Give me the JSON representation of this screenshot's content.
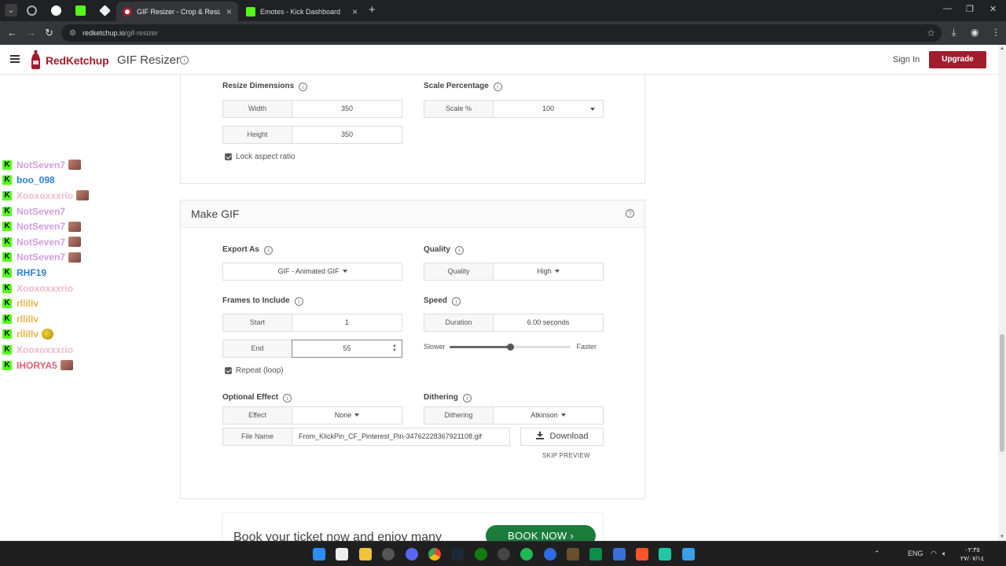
{
  "browser": {
    "tabs": [
      {
        "title": "GIF Resizer - Crop & Resize Ani",
        "active": true
      },
      {
        "title": "Emotes - Kick Dashboard",
        "active": false
      }
    ],
    "url_host": "redketchup.io",
    "url_path": "/gif-resizer"
  },
  "header": {
    "brand": "RedKetchup",
    "title": "GIF Resizer",
    "sign_in": "Sign In",
    "upgrade": "Upgrade"
  },
  "resize": {
    "dimensions_label": "Resize Dimensions",
    "width_label": "Width",
    "width_value": "350",
    "height_label": "Height",
    "height_value": "350",
    "lock_aspect": "Lock aspect ratio",
    "scale_title": "Scale Percentage",
    "scale_label": "Scale %",
    "scale_value": "100"
  },
  "make_gif": {
    "title": "Make GIF",
    "export_label": "Export As",
    "export_value": "GIF - Animated GIF",
    "quality_title": "Quality",
    "quality_label": "Quality",
    "quality_value": "High",
    "frames_title": "Frames to Include",
    "start_label": "Start",
    "start_value": "1",
    "end_label": "End",
    "end_value": "55",
    "repeat_label": "Repeat (loop)",
    "speed_title": "Speed",
    "duration_label": "Duration",
    "duration_value": "6.00 seconds",
    "slower": "Slower",
    "faster": "Faster",
    "speed_level": 0.5,
    "effect_title": "Optional Effect",
    "effect_label": "Effect",
    "effect_value": "None",
    "dithering_title": "Dithering",
    "dithering_label": "Dithering",
    "dithering_value": "Atkinson",
    "filename_label": "File Name",
    "filename_value": "From_KlickPin_CF_Pinterest_Pin-34762228367921108.gif",
    "download": "Download",
    "skip_preview": "SKIP PREVIEW"
  },
  "ad": {
    "text": "Book your ticket now and enjoy many",
    "button": "BOOK NOW"
  },
  "chat": [
    {
      "name": "NotSeven7",
      "color": "#d59be8",
      "emote": "face"
    },
    {
      "name": "boo_098",
      "color": "#2f7fd6",
      "emote": ""
    },
    {
      "name": "Xooxoxxxrio",
      "color": "#f3b8cb",
      "emote": "face"
    },
    {
      "name": "NotSeven7",
      "color": "#d59be8",
      "emote": ""
    },
    {
      "name": "NotSeven7",
      "color": "#d59be8",
      "emote": "face"
    },
    {
      "name": "NotSeven7",
      "color": "#d59be8",
      "emote": "face"
    },
    {
      "name": "NotSeven7",
      "color": "#d59be8",
      "emote": "face"
    },
    {
      "name": "RHF19",
      "color": "#2f7fd6",
      "emote": ""
    },
    {
      "name": "Xooxoxxxrio",
      "color": "#f3b8cb",
      "emote": ""
    },
    {
      "name": "rllillv",
      "color": "#e7b347",
      "emote": ""
    },
    {
      "name": "rllillv",
      "color": "#e7b347",
      "emote": ""
    },
    {
      "name": "rllillv",
      "color": "#e7b347",
      "emote": "bird"
    },
    {
      "name": "Xooxoxxxrio",
      "color": "#f3b8cb",
      "emote": ""
    },
    {
      "name": "IHORYA5",
      "color": "#e05d75",
      "emote": "face"
    }
  ],
  "taskbar": {
    "lang": "ENG",
    "time": "٠٢:٣٥",
    "date": "٢٧/٠٧/١٤"
  },
  "colors": {
    "brand": "#a11d2e",
    "kick_green": "#53fc18",
    "book_green": "#1b7c3b"
  }
}
